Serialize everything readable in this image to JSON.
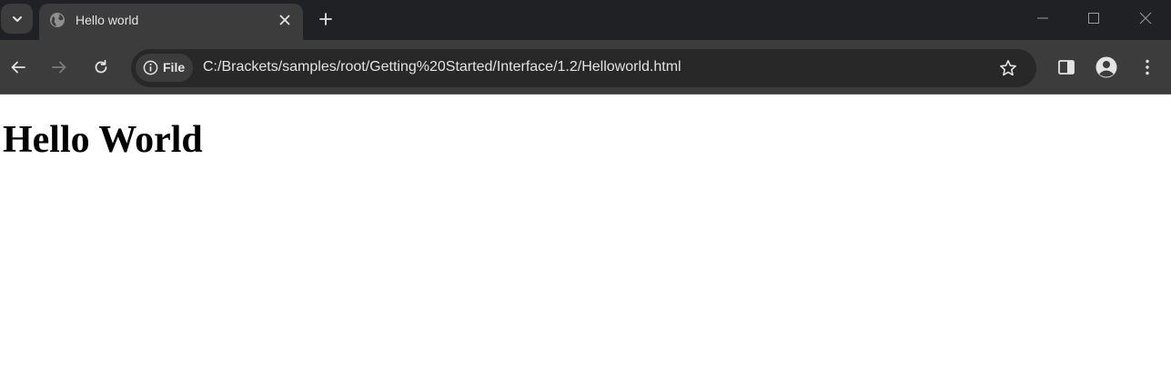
{
  "browser": {
    "tab": {
      "title": "Hello world",
      "favicon": "globe-icon"
    },
    "address_bar": {
      "chip_label": "File",
      "url": "C:/Brackets/samples/root/Getting%20Started/Interface/1.2/Helloworld.html"
    },
    "icons": {
      "tab_search": "chevron-down-icon",
      "close_tab": "close-icon",
      "new_tab": "plus-icon",
      "minimize": "minimize-icon",
      "maximize": "maximize-icon",
      "close_window": "close-icon",
      "back": "arrow-left-icon",
      "forward": "arrow-right-icon",
      "reload": "reload-icon",
      "site_info": "info-icon",
      "bookmark": "star-icon",
      "side_panel": "side-panel-icon",
      "profile": "profile-icon",
      "menu": "kebab-menu-icon"
    },
    "colors": {
      "frame": "#202124",
      "toolbar": "#3c3c3c",
      "omnibox": "#282828",
      "text": "#e3e3e3"
    }
  },
  "page": {
    "heading": "Hello World"
  }
}
